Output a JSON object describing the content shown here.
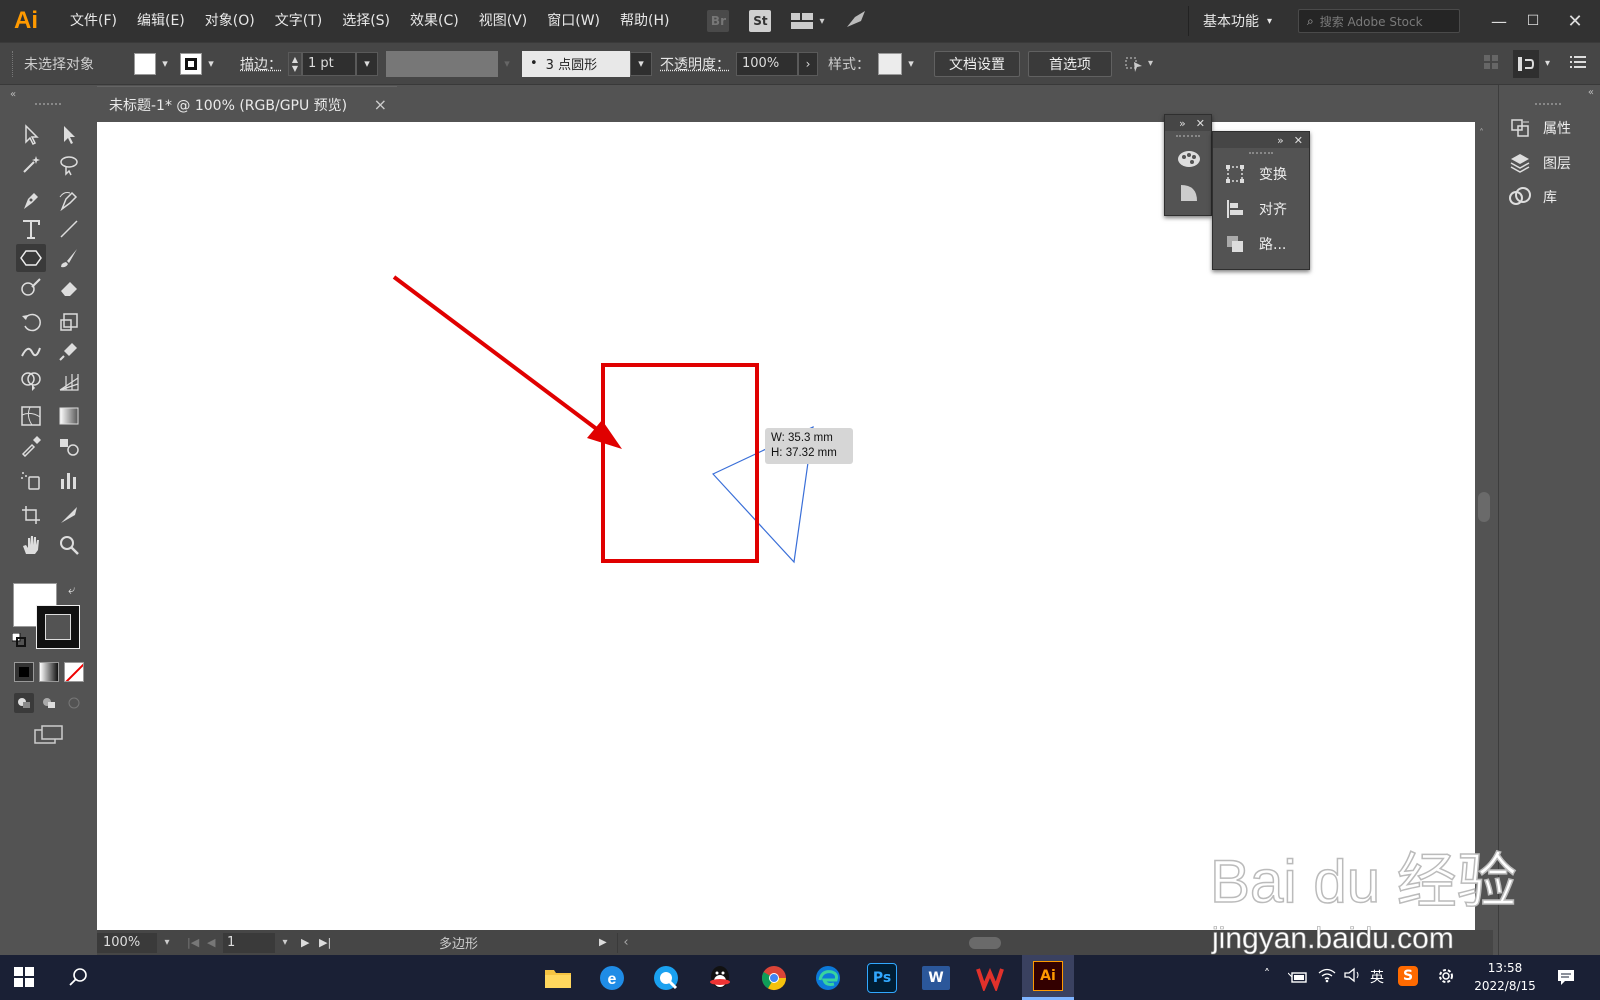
{
  "app": {
    "logo": "Ai"
  },
  "menu": [
    "文件(F)",
    "编辑(E)",
    "对象(O)",
    "文字(T)",
    "选择(S)",
    "效果(C)",
    "视图(V)",
    "窗口(W)",
    "帮助(H)"
  ],
  "menubar_icons": {
    "bridge": "Br",
    "stock": "St"
  },
  "workspace": "基本功能",
  "stock_search_placeholder": "搜索 Adobe Stock",
  "control": {
    "selection_label": "未选择对象",
    "stroke_label": "描边：",
    "stroke_value": "1 pt",
    "brush_value": "3 点圆形",
    "brush_bullet": "•",
    "opacity_label": "不透明度：",
    "opacity_value": "100%",
    "style_label": "样式：",
    "doc_settings": "文档设置",
    "preferences": "首选项"
  },
  "doc_tab": {
    "title": "未标题-1* @ 100% (RGB/GPU 预览)",
    "close": "×"
  },
  "dimension_tip": {
    "w": "W: 35.3 mm",
    "h": "H: 37.32 mm"
  },
  "status": {
    "zoom": "100%",
    "artboard": "1",
    "tool_name": "多边形"
  },
  "right_panel": {
    "properties": "属性",
    "layers": "图层",
    "libraries": "库"
  },
  "float_panel": {
    "transform": "变换",
    "align": "对齐",
    "pathfinder": "路..."
  },
  "taskbar": {
    "apps": [
      "file-explorer",
      "ie",
      "qq-browser",
      "qq",
      "chrome",
      "edge",
      "photoshop",
      "word",
      "wps",
      "illustrator"
    ],
    "app_labels": {
      "ps": "Ps",
      "word": "W",
      "ai": "Ai"
    },
    "ime": "英",
    "time": "13:58",
    "date": "2022/8/15"
  },
  "watermark": {
    "brand": "Bai du 经验",
    "url": "jingyan.baidu.com"
  },
  "colors": {
    "accent_orange": "#ff9a00",
    "annotation_red": "#e00000",
    "shape_blue": "#3a6fd8",
    "ps_blue": "#31a8ff",
    "ai_orange": "#ff9a00"
  }
}
